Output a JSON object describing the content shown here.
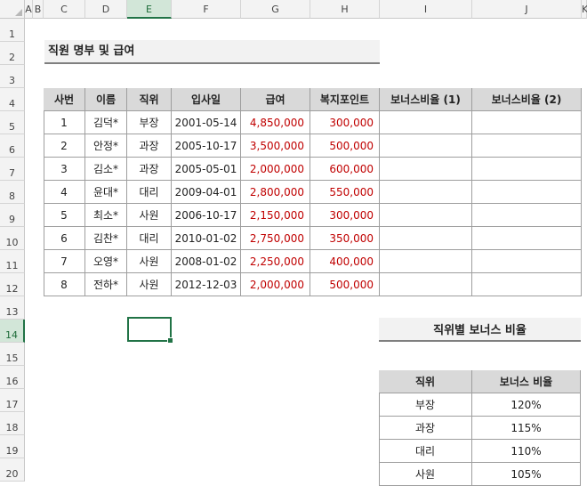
{
  "sheet": {
    "columns": [
      "A",
      "B",
      "C",
      "D",
      "E",
      "F",
      "G",
      "H",
      "I",
      "J",
      "K"
    ],
    "rows": [
      "1",
      "2",
      "3",
      "4",
      "5",
      "6",
      "7",
      "8",
      "9",
      "10",
      "11",
      "12",
      "13",
      "14",
      "15",
      "16",
      "17",
      "18",
      "19",
      "20"
    ],
    "selected_column": "E",
    "selected_row": "14"
  },
  "title": "직원 명부 및 급여",
  "employee_table": {
    "headers": [
      "사번",
      "이름",
      "직위",
      "입사일",
      "급여",
      "복지포인트",
      "보너스비율 (1)",
      "보너스비율 (2)"
    ],
    "rows": [
      [
        "1",
        "김덕*",
        "부장",
        "2001-05-14",
        "4,850,000",
        "300,000",
        "",
        ""
      ],
      [
        "2",
        "안정*",
        "과장",
        "2005-10-17",
        "3,500,000",
        "500,000",
        "",
        ""
      ],
      [
        "3",
        "김소*",
        "과장",
        "2005-05-01",
        "2,000,000",
        "600,000",
        "",
        ""
      ],
      [
        "4",
        "윤대*",
        "대리",
        "2009-04-01",
        "2,800,000",
        "550,000",
        "",
        ""
      ],
      [
        "5",
        "최소*",
        "사원",
        "2006-10-17",
        "2,150,000",
        "300,000",
        "",
        ""
      ],
      [
        "6",
        "김찬*",
        "대리",
        "2010-01-02",
        "2,750,000",
        "350,000",
        "",
        ""
      ],
      [
        "7",
        "오영*",
        "사원",
        "2008-01-02",
        "2,250,000",
        "400,000",
        "",
        ""
      ],
      [
        "8",
        "전하*",
        "사원",
        "2012-12-03",
        "2,000,000",
        "500,000",
        "",
        ""
      ]
    ]
  },
  "bonus_table": {
    "title": "직위별 보너스 비율",
    "headers": [
      "직위",
      "보너스 비율"
    ],
    "rows": [
      [
        "부장",
        "120%"
      ],
      [
        "과장",
        "115%"
      ],
      [
        "대리",
        "110%"
      ],
      [
        "사원",
        "105%"
      ]
    ]
  },
  "colors": {
    "accent": "#217346",
    "number_text": "#c00000",
    "header_fill": "#d9d9d9"
  }
}
